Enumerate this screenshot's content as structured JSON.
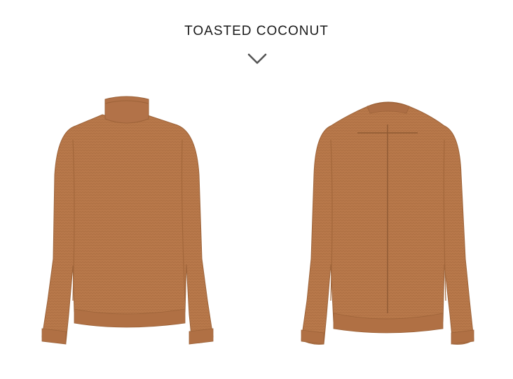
{
  "product": {
    "color_name": "TOASTED COCONUT",
    "colors": {
      "sweater": "#b8784a",
      "sweater_shadow": "#9d6339",
      "sweater_highlight": "#c48756",
      "title_text": "#1a1a1a",
      "chevron": "#555555"
    },
    "views": [
      {
        "name": "front",
        "icon": "sweater-front"
      },
      {
        "name": "back",
        "icon": "sweater-back"
      }
    ],
    "toggle_icon": "chevron-down-icon"
  }
}
